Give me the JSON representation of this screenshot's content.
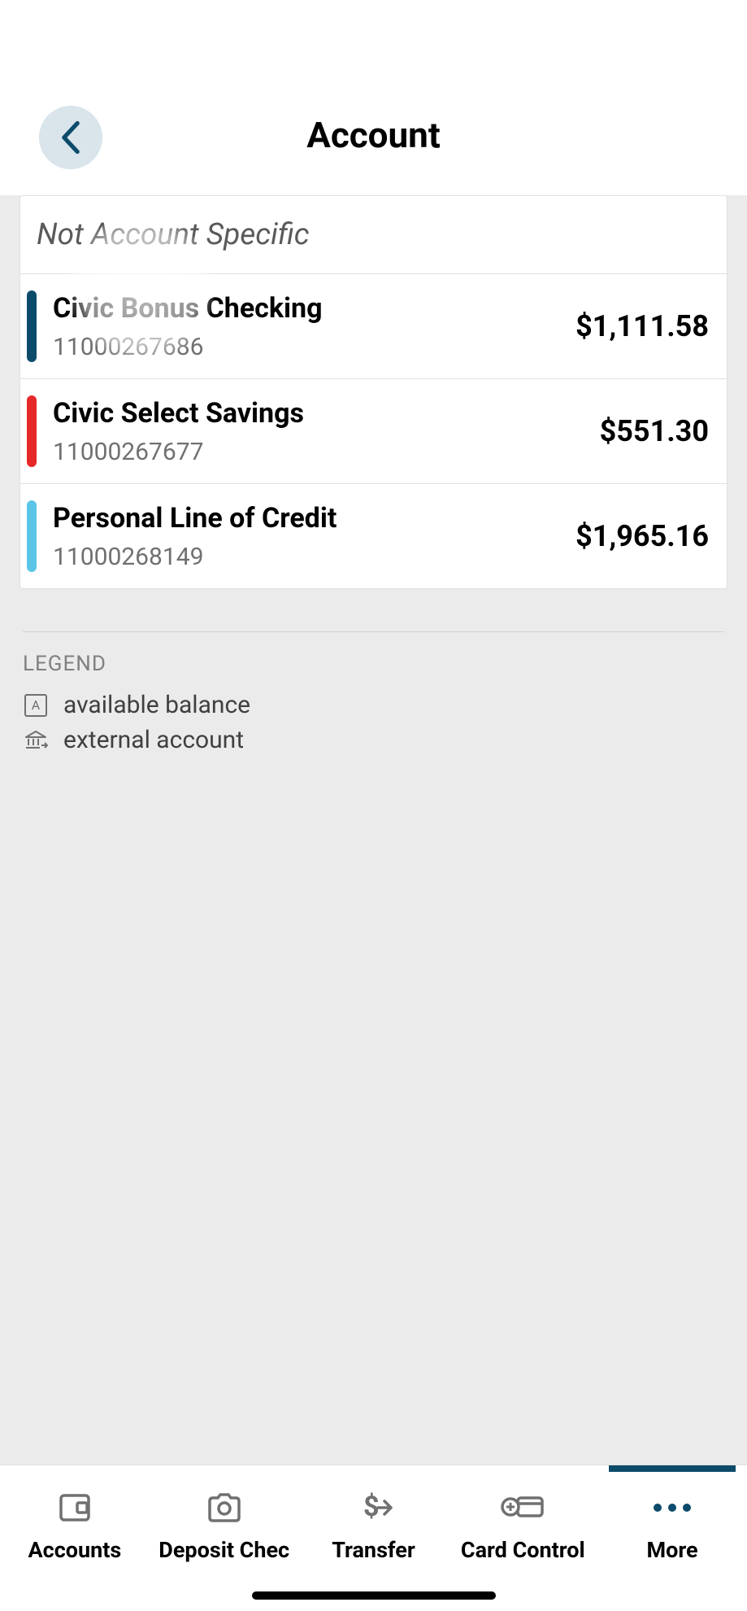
{
  "header": {
    "title": "Account"
  },
  "sectionHeader": "Not Account Specific",
  "accounts": [
    {
      "name": "Civic Bonus Checking",
      "number": "11000267686",
      "balance": "$1,111.58",
      "color": "#0d4b6b"
    },
    {
      "name": "Civic Select Savings",
      "number": "11000267677",
      "balance": "$551.30",
      "color": "#e62828"
    },
    {
      "name": "Personal Line of Credit",
      "number": "11000268149",
      "balance": "$1,965.16",
      "color": "#5bc5e8"
    }
  ],
  "legend": {
    "title": "LEGEND",
    "items": [
      {
        "label": "available balance"
      },
      {
        "label": "external account"
      }
    ]
  },
  "nav": {
    "items": [
      {
        "label": "Accounts"
      },
      {
        "label": "Deposit Chec"
      },
      {
        "label": "Transfer"
      },
      {
        "label": "Card Control"
      },
      {
        "label": "More"
      }
    ],
    "activeIndex": 4
  }
}
